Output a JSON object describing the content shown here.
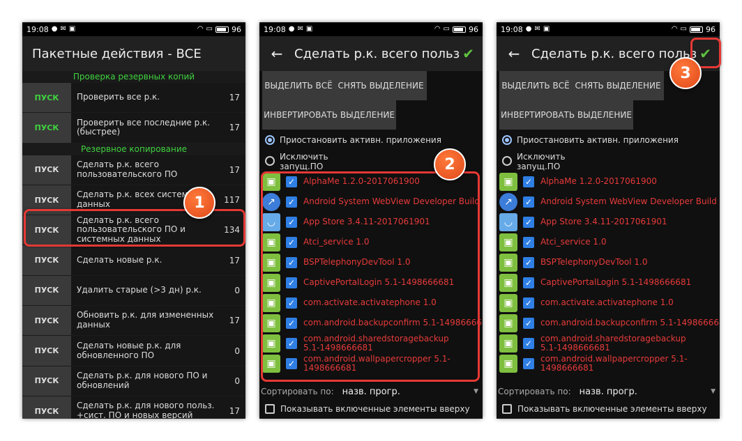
{
  "status": {
    "time": "19:08",
    "battery": "96"
  },
  "p1": {
    "title": "Пакетные действия - ВСЕ",
    "section1": "Проверка резервных копий",
    "section2": "Резервное копирование",
    "rows_top": [
      {
        "btn": "ПУСК",
        "label": "Проверить все р.к.",
        "count": "17"
      },
      {
        "btn": "ПУСК",
        "label": "Проверить все последние р.к. (быстрее)",
        "count": "17"
      }
    ],
    "rows": [
      {
        "btn": "ПУСК",
        "label": "Сделать р.к. всего пользовательского ПО",
        "count": "17"
      },
      {
        "btn": "ПУСК",
        "label": "Сделать р.к. всех системных данных",
        "count": "117"
      },
      {
        "btn": "ПУСК",
        "label": "Сделать р.к. всего пользовательского ПО и системных данных",
        "count": "134"
      },
      {
        "btn": "ПУСК",
        "label": "Сделать новые р.к.",
        "count": "17"
      },
      {
        "btn": "ПУСК",
        "label": "Удалить старые (>3 дн) р.к.",
        "count": "0"
      },
      {
        "btn": "ПУСК",
        "label": "Обновить р.к. для измененных данных",
        "count": "17"
      },
      {
        "btn": "ПУСК",
        "label": "Сделать новые р.к. для обновленного ПО",
        "count": "0"
      },
      {
        "btn": "ПУСК",
        "label": "Сделать р.к. для нового ПО и обновлений",
        "count": "0"
      },
      {
        "btn": "ПУСК",
        "label": "Сделать р.к. для нового польз. +сист. ПО и новых версий",
        "count": "17"
      }
    ]
  },
  "p2": {
    "title": "Сделать р.к. всего польз",
    "select_all": "ВЫДЕЛИТЬ ВСЁ",
    "deselect": "СНЯТЬ ВЫДЕЛЕНИЕ",
    "invert": "ИНВЕРТИРОВАТЬ ВЫДЕЛЕНИЕ",
    "radio1": "Приостановить активн. приложения",
    "radio2": "Исключить запущ.ПО",
    "apps": [
      {
        "icon": "android-icon",
        "name": "AlphaMe 1.2.0-2017061900"
      },
      {
        "icon": "webview-icon",
        "name": "Android System WebView Developer Build"
      },
      {
        "icon": "store-icon",
        "name": "App Store 3.4.11-2017061901"
      },
      {
        "icon": "android-icon",
        "name": "Atci_service 1.0"
      },
      {
        "icon": "android-icon",
        "name": "BSPTelephonyDevTool 1.0"
      },
      {
        "icon": "android-icon",
        "name": "CaptivePortalLogin 5.1-1498666681"
      },
      {
        "icon": "android-icon",
        "name": "com.activate.activatephone 1.0"
      },
      {
        "icon": "android-icon",
        "name": "com.android.backupconfirm 5.1-1498666681"
      },
      {
        "icon": "android-icon",
        "name": "com.android.sharedstoragebackup 5.1-1498666681"
      },
      {
        "icon": "android-icon",
        "name": "com.android.wallpapercropper 5.1-1498666681"
      }
    ],
    "apps_p2_backupconfirm": "com.android.backupconfirm 5.1-149866668",
    "sort_label": "Сортировать по:",
    "sort_value": "назв. прогр.",
    "show_enabled": "Показывать включенные элементы вверху"
  },
  "badges": [
    "1",
    "2",
    "3"
  ],
  "colors": {
    "accent_green": "#3fd23f",
    "app_red": "#e83a3a",
    "checkbox_blue": "#2f7fe5",
    "highlight_red": "#e53935"
  }
}
